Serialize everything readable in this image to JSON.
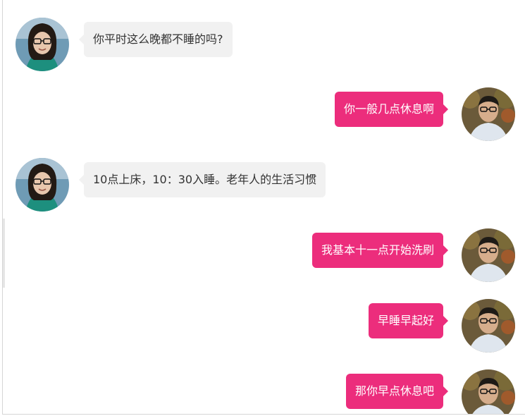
{
  "colors": {
    "incoming_bubble": "#f1f1f1",
    "outgoing_bubble": "#ec2d7c",
    "incoming_text": "#333333",
    "outgoing_text": "#ffffff",
    "divider": "#d6d6d6"
  },
  "messages": [
    {
      "sender": "her",
      "text": "你平时这么晚都不睡的吗?"
    },
    {
      "sender": "me",
      "text": "你一般几点休息啊"
    },
    {
      "sender": "her",
      "text": "10点上床，10：30入睡。老年人的生活习惯"
    },
    {
      "sender": "me",
      "text": "我基本十一点开始洗刷"
    },
    {
      "sender": "me",
      "text": "早睡早起好"
    },
    {
      "sender": "me",
      "text": "那你早点休息吧"
    }
  ]
}
